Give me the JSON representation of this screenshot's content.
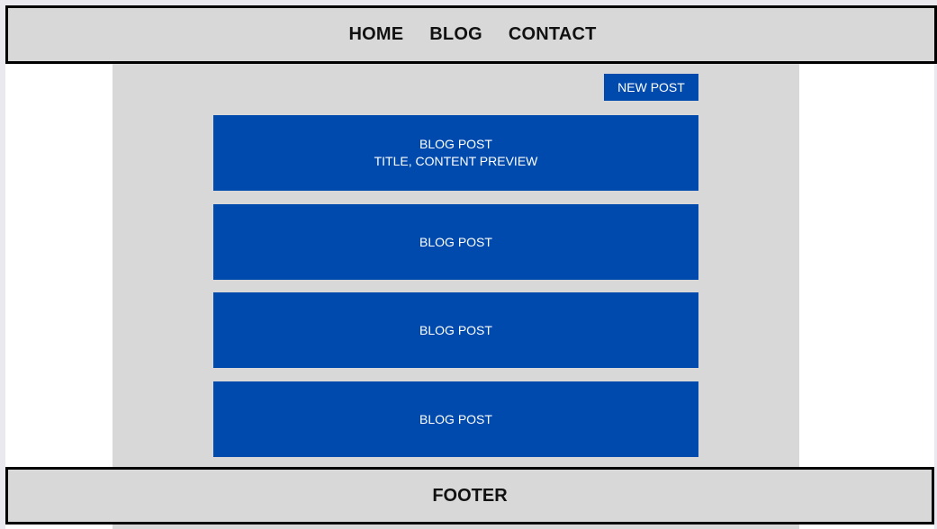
{
  "header": {
    "nav": [
      "HOME",
      "BLOG",
      "CONTACT"
    ]
  },
  "main": {
    "new_post_label": "NEW POST",
    "posts": [
      {
        "title": "BLOG POST",
        "subtitle": "TITLE, CONTENT PREVIEW"
      },
      {
        "title": "BLOG POST"
      },
      {
        "title": "BLOG POST"
      },
      {
        "title": "BLOG POST"
      }
    ]
  },
  "footer": {
    "label": "FOOTER"
  },
  "colors": {
    "accent": "#004aad",
    "panel": "#d8d8d8",
    "border": "#000000",
    "background": "#ffffff"
  }
}
